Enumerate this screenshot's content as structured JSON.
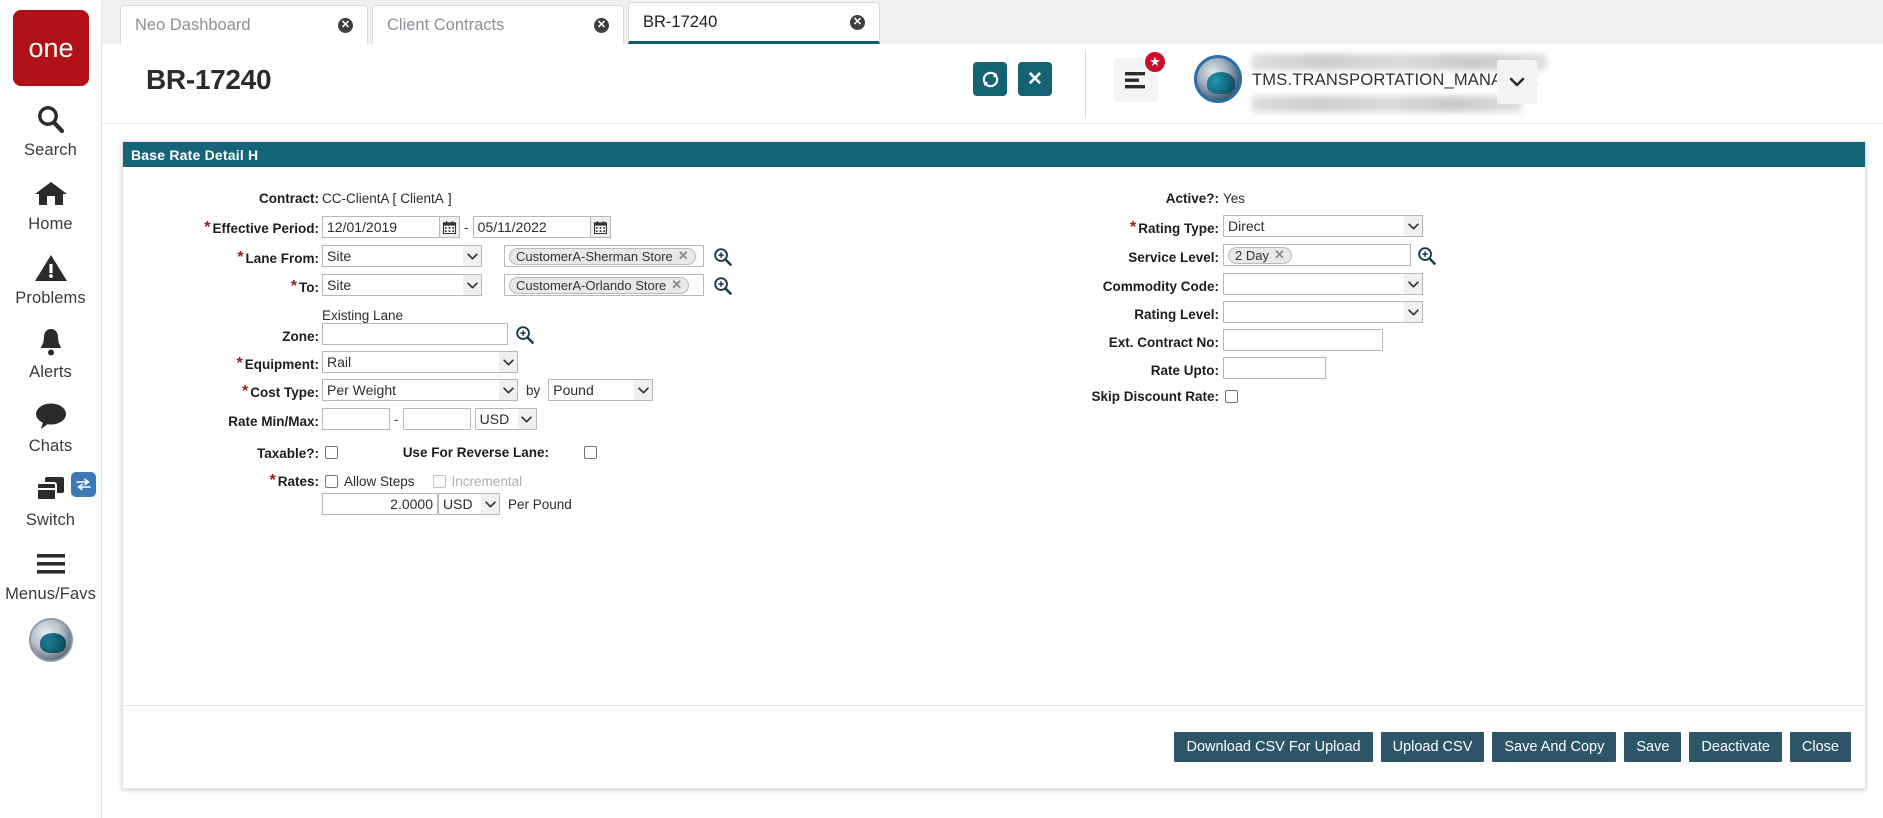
{
  "app": {
    "brand": "one",
    "rail": [
      {
        "label": "Search",
        "icon": "search-icon"
      },
      {
        "label": "Home",
        "icon": "home-icon"
      },
      {
        "label": "Problems",
        "icon": "warning-triangle-icon"
      },
      {
        "label": "Alerts",
        "icon": "bell-icon"
      },
      {
        "label": "Chats",
        "icon": "chat-bubble-icon"
      },
      {
        "label": "Switch",
        "icon": "windows-stack-icon",
        "badge_icon": "swap-arrows-icon"
      },
      {
        "label": "Menus/Favs",
        "icon": "hamburger-icon"
      }
    ]
  },
  "tabs": [
    {
      "label": "Neo Dashboard",
      "close": "✕",
      "active": false
    },
    {
      "label": "Client Contracts",
      "close": "✕",
      "active": false
    },
    {
      "label": "BR-17240",
      "close": "✕",
      "active": true
    }
  ],
  "header": {
    "title": "BR-17240",
    "refresh_icon": "refresh-icon",
    "close_icon": "✕",
    "menu_icon": "menu-list-icon",
    "badge_icon": "★",
    "user_name": "TMS.TRANSPORTATION_MANAGER",
    "caret_icon": "⌄"
  },
  "card": {
    "title": "Base Rate Detail  H"
  },
  "form": {
    "contract": {
      "label": "Contract:",
      "value": "CC-ClientA [",
      "link": "ClientA",
      "suffix": "]"
    },
    "effective_period": {
      "label": "Effective Period:",
      "required": "*",
      "from": "12/01/2019",
      "to": "05/11/2022",
      "separator": "-",
      "calendar_icon": "calendar-icon"
    },
    "lane_from": {
      "label": "Lane From:",
      "required": "*",
      "type": "Site",
      "chip": "CustomerA-Sherman Store",
      "chip_close": "✕",
      "search_icon": "magnifier-plus-icon"
    },
    "lane_to": {
      "label": "To:",
      "required": "*",
      "type": "Site",
      "chip": "CustomerA-Orlando Store",
      "chip_close": "✕",
      "search_icon": "magnifier-plus-icon"
    },
    "existing_lane": {
      "label": "Existing Lane"
    },
    "zone": {
      "label": "Zone:",
      "value": "",
      "search_icon": "magnifier-plus-icon"
    },
    "equipment": {
      "label": "Equipment:",
      "required": "*",
      "value": "Rail"
    },
    "cost_type": {
      "label": "Cost Type:",
      "required": "*",
      "value": "Per Weight",
      "by_label": "by",
      "by_value": "Pound"
    },
    "rate_min_max": {
      "label": "Rate Min/Max:",
      "min": "",
      "max": "",
      "separator": "-",
      "currency": "USD"
    },
    "taxable": {
      "label": "Taxable?:",
      "checked": false
    },
    "use_reverse_lane": {
      "label": "Use For Reverse Lane:",
      "checked": false
    },
    "rates": {
      "label": "Rates:",
      "required": "*",
      "allow_steps_label": "Allow Steps",
      "allow_steps_checked": false,
      "incremental_label": "Incremental",
      "incremental_checked": false,
      "incremental_disabled": true,
      "amount": "2.0000",
      "currency": "USD",
      "unit": "Per Pound"
    },
    "active": {
      "label": "Active?:",
      "value": "Yes"
    },
    "rating_type": {
      "label": "Rating Type:",
      "required": "*",
      "value": "Direct"
    },
    "service_level": {
      "label": "Service Level:",
      "chip": "2 Day",
      "chip_close": "✕",
      "search_icon": "magnifier-plus-icon"
    },
    "commodity_code": {
      "label": "Commodity Code:",
      "value": ""
    },
    "rating_level": {
      "label": "Rating Level:",
      "value": ""
    },
    "ext_contract_no": {
      "label": "Ext. Contract No:",
      "value": ""
    },
    "rate_upto": {
      "label": "Rate Upto:",
      "value": ""
    },
    "skip_discount_rate": {
      "label": "Skip Discount Rate:",
      "checked": false
    }
  },
  "footer": {
    "buttons": [
      {
        "label": "Download CSV For Upload"
      },
      {
        "label": "Upload CSV"
      },
      {
        "label": "Save And Copy"
      },
      {
        "label": "Save"
      },
      {
        "label": "Deactivate"
      },
      {
        "label": "Close"
      }
    ]
  },
  "colors": {
    "brand_red": "#b01116",
    "teal_header": "#15657a",
    "teal_button": "#146374",
    "footer_button": "#2c5667",
    "required_red": "#9b1b1b",
    "link_teal": "#2f7d92"
  }
}
